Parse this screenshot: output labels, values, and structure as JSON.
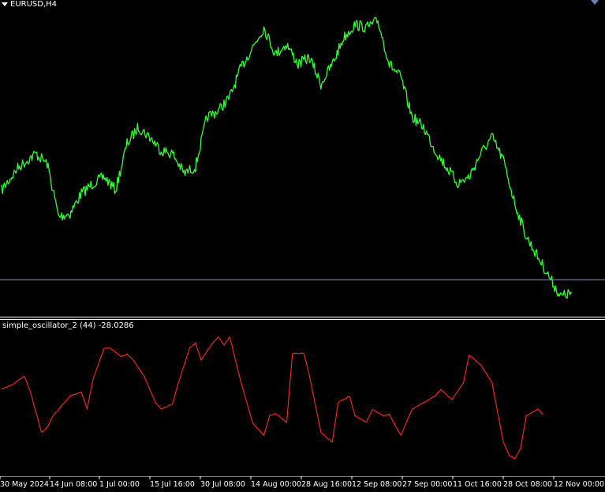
{
  "header": {
    "symbol": "EURUSD,H4",
    "dropdown_icon": "triangle-down-icon"
  },
  "indicator": {
    "label": "simple_oscillator_2 (44) -28.0286"
  },
  "colors": {
    "background": "#000000",
    "price_line": "#33ff33",
    "oscillator_line": "#ff2a1a",
    "level_line": "#8796b8",
    "separator": "#ffffff",
    "text": "#ffffff"
  },
  "chart_data": [
    {
      "type": "line",
      "name_label": "EURUSD,H4",
      "series": [
        {
          "name": "EURUSD,H4",
          "x": [
            0,
            3,
            6,
            8,
            10,
            12,
            14,
            16,
            18,
            20,
            22,
            24,
            26,
            28,
            30,
            32,
            34,
            36,
            38,
            40,
            42,
            44,
            46,
            48,
            50,
            52,
            54,
            56,
            58,
            60,
            62,
            64,
            66,
            68,
            70,
            72,
            74,
            76,
            78,
            80,
            82,
            84,
            86,
            88,
            90,
            92,
            94,
            96,
            98,
            100
          ],
          "values": [
            1.076,
            1.083,
            1.087,
            1.084,
            1.068,
            1.069,
            1.075,
            1.078,
            1.08,
            1.076,
            1.09,
            1.095,
            1.092,
            1.088,
            1.087,
            1.081,
            1.083,
            1.098,
            1.1,
            1.104,
            1.113,
            1.119,
            1.125,
            1.117,
            1.12,
            1.114,
            1.116,
            1.108,
            1.114,
            1.122,
            1.126,
            1.125,
            1.127,
            1.114,
            1.11,
            1.098,
            1.095,
            1.088,
            1.083,
            1.078,
            1.08,
            1.087,
            1.092,
            1.085,
            1.072,
            1.062,
            1.056,
            1.05,
            1.044,
            1.045
          ]
        }
      ],
      "ylim": [
        1.04,
        1.13
      ],
      "level": 1.049,
      "grid": false
    },
    {
      "type": "line",
      "name_label": "simple_oscillator_2 (44) -28.0286",
      "series": [
        {
          "name": "simple_oscillator_2 (44)",
          "x": [
            0,
            2,
            4,
            5,
            7,
            8,
            9,
            11,
            12,
            14,
            15,
            16,
            18,
            19,
            21,
            22,
            23,
            25,
            27,
            28,
            30,
            31,
            33,
            34,
            35,
            37,
            38,
            39,
            40,
            42,
            43,
            44,
            46,
            47,
            48,
            50,
            51,
            53,
            54,
            56,
            58,
            59,
            61,
            62,
            64,
            65,
            67,
            68,
            70,
            72,
            74,
            76,
            77,
            79,
            81,
            82,
            84,
            86,
            88,
            89,
            90,
            91,
            92,
            94,
            95
          ],
          "values": [
            10,
            18,
            30,
            8,
            -55,
            -48,
            -30,
            -10,
            0,
            6,
            -20,
            25,
            72,
            73,
            60,
            64,
            56,
            30,
            -10,
            -20,
            -12,
            20,
            73,
            80,
            55,
            80,
            90,
            77,
            90,
            20,
            -10,
            -40,
            -60,
            -30,
            -26,
            -40,
            64,
            65,
            30,
            -55,
            -70,
            -10,
            0,
            -30,
            -40,
            -20,
            -30,
            -28,
            -60,
            -20,
            -10,
            0,
            10,
            -5,
            20,
            62,
            48,
            20,
            -70,
            -90,
            -95,
            -80,
            -30,
            -20,
            -28
          ]
        }
      ],
      "ylim": [
        -100,
        100
      ],
      "grid": false
    }
  ],
  "x_axis": {
    "tick_labels": [
      "30 May 2024",
      "14 Jun 08:00",
      "1 Jul 00:00",
      "15 Jul 16:00",
      "30 Jul 08:00",
      "14 Aug 00:00",
      "28 Aug 16:00",
      "12 Sep 08:00",
      "27 Sep 00:00",
      "11 Oct 16:00",
      "28 Oct 08:00",
      "12 Nov 00:00"
    ]
  }
}
